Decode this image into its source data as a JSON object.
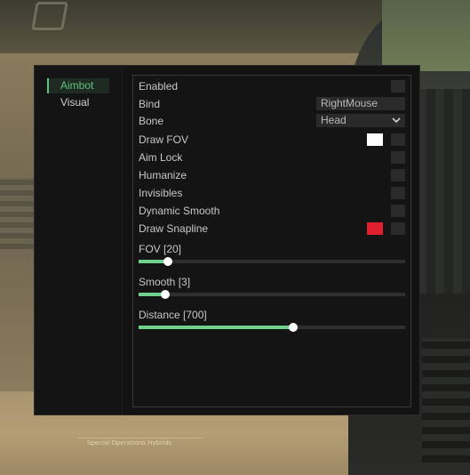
{
  "menu": {
    "tabs": [
      {
        "label": "Aimbot",
        "active": true
      },
      {
        "label": "Visual",
        "active": false
      }
    ],
    "accent_color": "#5ec27a",
    "options": {
      "enabled": {
        "label": "Enabled",
        "checked": false
      },
      "bind": {
        "label": "Bind",
        "value": "RightMouse"
      },
      "bone": {
        "label": "Bone",
        "value": "Head",
        "icon": "chevron-down-icon"
      },
      "draw_fov": {
        "label": "Draw FOV",
        "checked": false,
        "color": "#ffffff"
      },
      "aim_lock": {
        "label": "Aim Lock",
        "checked": false
      },
      "humanize": {
        "label": "Humanize",
        "checked": false
      },
      "invisibles": {
        "label": "Invisibles",
        "checked": false
      },
      "dynamic_smooth": {
        "label": "Dynamic Smooth",
        "checked": false
      },
      "draw_snapline": {
        "label": "Draw Snapline",
        "checked": false,
        "color": "#e0202e"
      }
    },
    "sliders": {
      "fov": {
        "label": "FOV [20]",
        "value": 20,
        "fraction": 0.11
      },
      "smooth": {
        "label": "Smooth [3]",
        "value": 3,
        "fraction": 0.1
      },
      "distance": {
        "label": "Distance [700]",
        "value": 700,
        "fraction": 0.58
      }
    }
  },
  "background": {
    "sign_text": "Special Operations Hybrids"
  }
}
